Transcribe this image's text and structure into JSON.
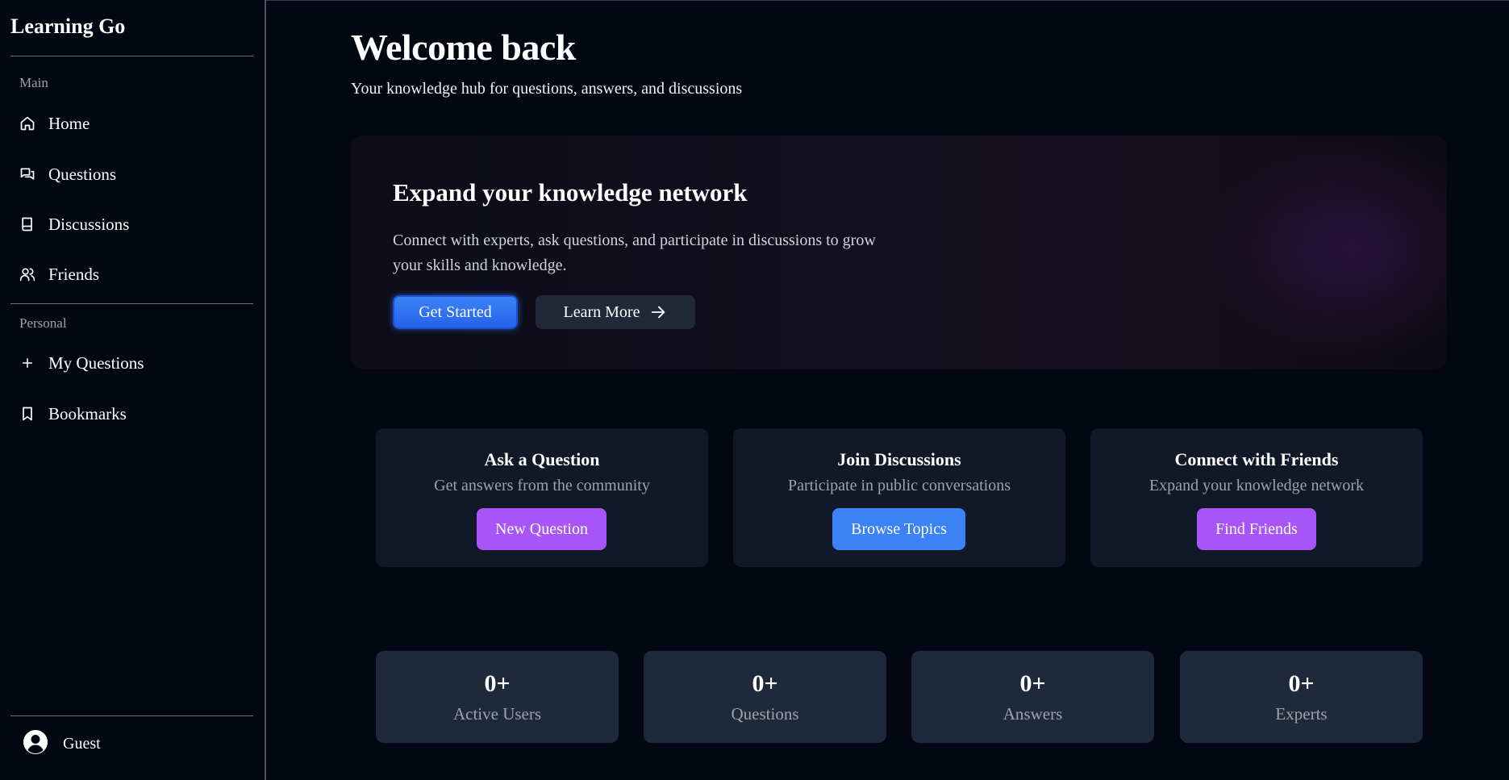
{
  "sidebar": {
    "brand": "Learning Go",
    "main_label": "Main",
    "main_items": [
      {
        "label": "Home",
        "icon": "home-icon"
      },
      {
        "label": "Questions",
        "icon": "chat-bubbles-icon"
      },
      {
        "label": "Discussions",
        "icon": "book-icon"
      },
      {
        "label": "Friends",
        "icon": "users-icon"
      }
    ],
    "personal_label": "Personal",
    "personal_items": [
      {
        "label": "My Questions",
        "icon": "plus-icon"
      },
      {
        "label": "Bookmarks",
        "icon": "bookmark-icon"
      }
    ],
    "user": {
      "name": "Guest",
      "icon": "user-circle-icon"
    }
  },
  "header": {
    "title": "Welcome back",
    "subtitle": "Your knowledge hub for questions, answers, and discussions"
  },
  "hero": {
    "title": "Expand your knowledge network",
    "text": "Connect with experts, ask questions, and participate in discussions to grow your skills and knowledge.",
    "primary_label": "Get Started",
    "secondary_label": "Learn More",
    "secondary_icon": "arrow-right-icon"
  },
  "cards": [
    {
      "title": "Ask a Question",
      "desc": "Get answers from the community",
      "button": "New Question",
      "color": "#a855f7"
    },
    {
      "title": "Join Discussions",
      "desc": "Participate in public conversations",
      "button": "Browse Topics",
      "color": "#3b82f6"
    },
    {
      "title": "Connect with Friends",
      "desc": "Expand your knowledge network",
      "button": "Find Friends",
      "color": "#a855f7"
    }
  ],
  "stats": [
    {
      "value": "0+",
      "label": "Active Users"
    },
    {
      "value": "0+",
      "label": "Questions"
    },
    {
      "value": "0+",
      "label": "Answers"
    },
    {
      "value": "0+",
      "label": "Experts"
    }
  ],
  "colors": {
    "background": "#030712",
    "card": "#111827",
    "stat_card": "#1e293b",
    "accent_blue": "#3b82f6",
    "accent_purple": "#a855f7"
  }
}
